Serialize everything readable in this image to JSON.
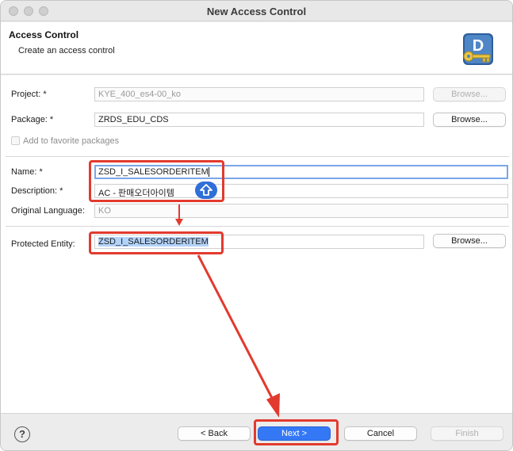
{
  "window": {
    "title": "New Access Control"
  },
  "header": {
    "title": "Access Control",
    "subtitle": "Create an access control",
    "icon": "wizard-key-icon"
  },
  "form": {
    "project": {
      "label": "Project: *",
      "value": "KYE_400_es4-00_ko",
      "browse": "Browse..."
    },
    "package": {
      "label": "Package: *",
      "value": "ZRDS_EDU_CDS",
      "browse": "Browse..."
    },
    "favorite": {
      "label": "Add to favorite packages"
    },
    "name": {
      "label": "Name: *",
      "value": "ZSD_I_SALESORDERITEM"
    },
    "description": {
      "label": "Description: *",
      "value": "AC - 판매오더아이템"
    },
    "language": {
      "label": "Original Language:",
      "value": "KO"
    },
    "entity": {
      "label": "Protected Entity:",
      "value": "ZSD_I_SALESORDERITEM",
      "browse": "Browse..."
    }
  },
  "footer": {
    "help": "?",
    "back": "< Back",
    "next": "Next >",
    "cancel": "Cancel",
    "finish": "Finish"
  },
  "colors": {
    "annotation": "#e23a2e",
    "primary": "#3478f6"
  }
}
